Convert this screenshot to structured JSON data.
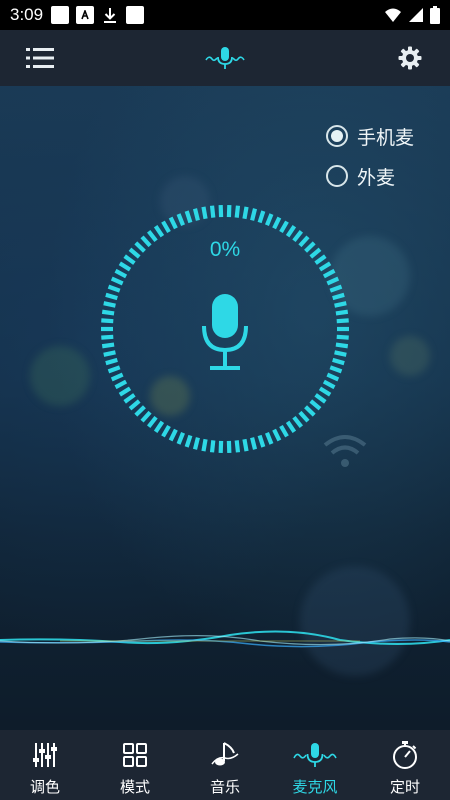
{
  "status_bar": {
    "time": "3:09"
  },
  "app_bar": {
    "menu_icon": "menu-list-icon",
    "center_icon": "microphone-wave-icon",
    "settings_icon": "gear-icon"
  },
  "mic_source": {
    "options": [
      {
        "label": "手机麦",
        "checked": true
      },
      {
        "label": "外麦",
        "checked": false
      }
    ]
  },
  "level": {
    "percent_text": "0%",
    "percent": 0
  },
  "colors": {
    "accent": "#2ed8e6",
    "bar_bg": "#1d2633"
  },
  "bottom_nav": {
    "items": [
      {
        "label": "调色",
        "icon": "sliders-icon"
      },
      {
        "label": "模式",
        "icon": "grid-icon"
      },
      {
        "label": "音乐",
        "icon": "music-note-icon"
      },
      {
        "label": "麦克风",
        "icon": "microphone-wave-icon",
        "active": true
      },
      {
        "label": "定时",
        "icon": "stopwatch-icon"
      }
    ]
  }
}
